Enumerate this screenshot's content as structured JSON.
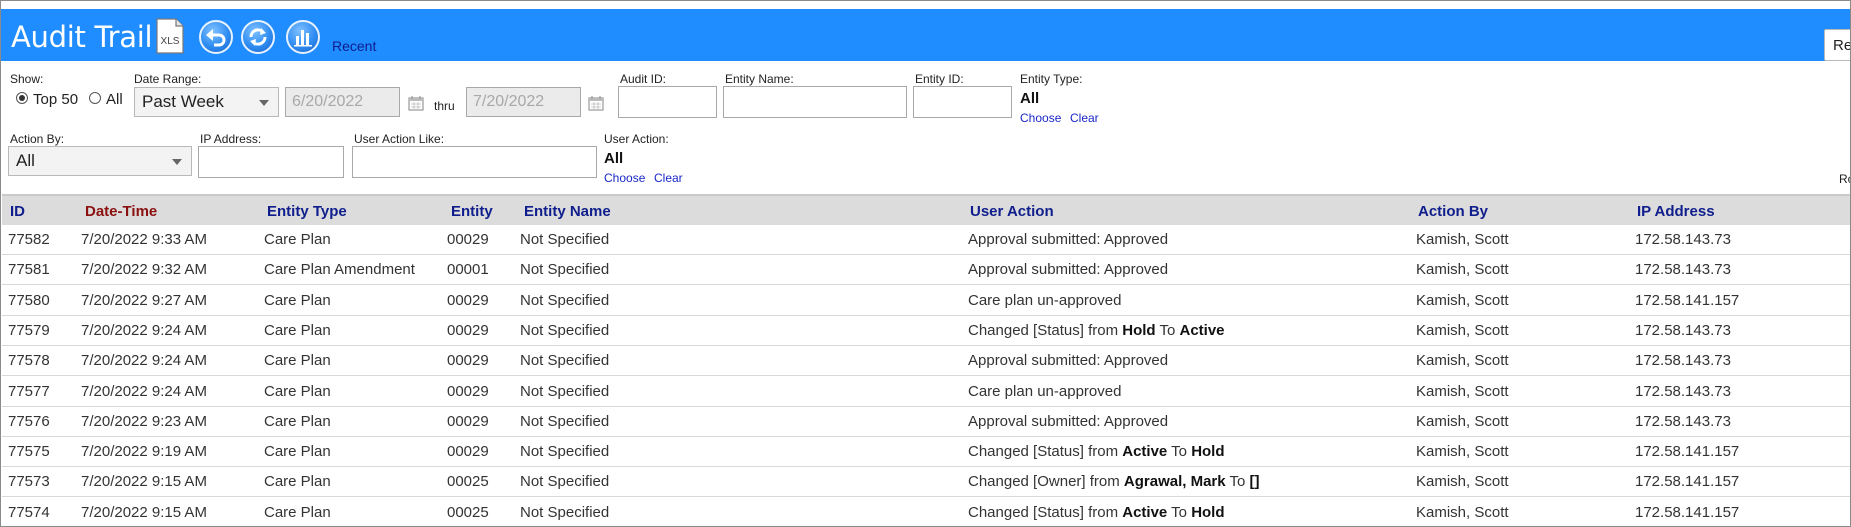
{
  "header": {
    "title": "Audit Trail",
    "xls_label": "XLS",
    "recent_label": "Recent",
    "right_button": "Re",
    "icons": [
      "xls-export-icon",
      "undo-arrow-icon",
      "refresh-icon",
      "chart-icon"
    ],
    "bar_color": "#1f8cff"
  },
  "filters": {
    "show": {
      "label": "Show:",
      "options": [
        "Top 50",
        "All"
      ],
      "selected": "Top 50"
    },
    "date_range": {
      "label": "Date Range:",
      "selected": "Past Week",
      "from": "6/20/2022",
      "thru_label": "thru",
      "to": "7/20/2022"
    },
    "audit_id": {
      "label": "Audit ID:",
      "value": ""
    },
    "entity_name": {
      "label": "Entity Name:",
      "value": ""
    },
    "entity_id": {
      "label": "Entity ID:",
      "value": ""
    },
    "entity_type": {
      "label": "Entity Type:",
      "value": "All",
      "choose": "Choose",
      "clear": "Clear"
    },
    "action_by": {
      "label": "Action By:",
      "selected": "All"
    },
    "ip_address": {
      "label": "IP Address:",
      "value": ""
    },
    "user_action_like": {
      "label": "User Action Like:",
      "value": ""
    },
    "user_action": {
      "label": "User Action:",
      "value": "All",
      "choose": "Choose",
      "clear": "Clear"
    },
    "right_edge_text": "Ro"
  },
  "table": {
    "columns": [
      "ID",
      "Date-Time",
      "Entity Type",
      "Entity",
      "Entity Name",
      "User Action",
      "Action By",
      "IP Address"
    ],
    "sorted_column": "Date-Time",
    "rows": [
      {
        "id": "77582",
        "datetime": "7/20/2022 9:33 AM",
        "entity_type": "Care Plan",
        "entity": "00029",
        "entity_name": "Not Specified",
        "action": [
          {
            "t": "Approval submitted: Approved"
          }
        ],
        "action_by": "Kamish, Scott",
        "ip": "172.58.143.73"
      },
      {
        "id": "77581",
        "datetime": "7/20/2022 9:32 AM",
        "entity_type": "Care Plan Amendment",
        "entity": "00001",
        "entity_name": "Not Specified",
        "action": [
          {
            "t": "Approval submitted: Approved"
          }
        ],
        "action_by": "Kamish, Scott",
        "ip": "172.58.143.73"
      },
      {
        "id": "77580",
        "datetime": "7/20/2022 9:27 AM",
        "entity_type": "Care Plan",
        "entity": "00029",
        "entity_name": "Not Specified",
        "action": [
          {
            "t": "Care plan un-approved"
          }
        ],
        "action_by": "Kamish, Scott",
        "ip": "172.58.141.157"
      },
      {
        "id": "77579",
        "datetime": "7/20/2022 9:24 AM",
        "entity_type": "Care Plan",
        "entity": "00029",
        "entity_name": "Not Specified",
        "action": [
          {
            "t": "Changed [Status] from "
          },
          {
            "t": "Hold",
            "b": true
          },
          {
            "t": " To "
          },
          {
            "t": "Active",
            "b": true
          }
        ],
        "action_by": "Kamish, Scott",
        "ip": "172.58.143.73"
      },
      {
        "id": "77578",
        "datetime": "7/20/2022 9:24 AM",
        "entity_type": "Care Plan",
        "entity": "00029",
        "entity_name": "Not Specified",
        "action": [
          {
            "t": "Approval submitted: Approved"
          }
        ],
        "action_by": "Kamish, Scott",
        "ip": "172.58.143.73"
      },
      {
        "id": "77577",
        "datetime": "7/20/2022 9:24 AM",
        "entity_type": "Care Plan",
        "entity": "00029",
        "entity_name": "Not Specified",
        "action": [
          {
            "t": "Care plan un-approved"
          }
        ],
        "action_by": "Kamish, Scott",
        "ip": "172.58.143.73"
      },
      {
        "id": "77576",
        "datetime": "7/20/2022 9:23 AM",
        "entity_type": "Care Plan",
        "entity": "00029",
        "entity_name": "Not Specified",
        "action": [
          {
            "t": "Approval submitted: Approved"
          }
        ],
        "action_by": "Kamish, Scott",
        "ip": "172.58.143.73"
      },
      {
        "id": "77575",
        "datetime": "7/20/2022 9:19 AM",
        "entity_type": "Care Plan",
        "entity": "00029",
        "entity_name": "Not Specified",
        "action": [
          {
            "t": "Changed [Status] from "
          },
          {
            "t": "Active",
            "b": true
          },
          {
            "t": " To "
          },
          {
            "t": "Hold",
            "b": true
          }
        ],
        "action_by": "Kamish, Scott",
        "ip": "172.58.141.157"
      },
      {
        "id": "77573",
        "datetime": "7/20/2022 9:15 AM",
        "entity_type": "Care Plan",
        "entity": "00025",
        "entity_name": "Not Specified",
        "action": [
          {
            "t": "Changed [Owner] from "
          },
          {
            "t": "Agrawal, Mark",
            "b": true
          },
          {
            "t": " To "
          },
          {
            "t": "[]",
            "b": true
          }
        ],
        "action_by": "Kamish, Scott",
        "ip": "172.58.141.157"
      },
      {
        "id": "77574",
        "datetime": "7/20/2022 9:15 AM",
        "entity_type": "Care Plan",
        "entity": "00025",
        "entity_name": "Not Specified",
        "action": [
          {
            "t": "Changed [Status] from "
          },
          {
            "t": "Active",
            "b": true
          },
          {
            "t": " To "
          },
          {
            "t": "Hold",
            "b": true
          }
        ],
        "action_by": "Kamish, Scott",
        "ip": "172.58.141.157"
      }
    ]
  }
}
